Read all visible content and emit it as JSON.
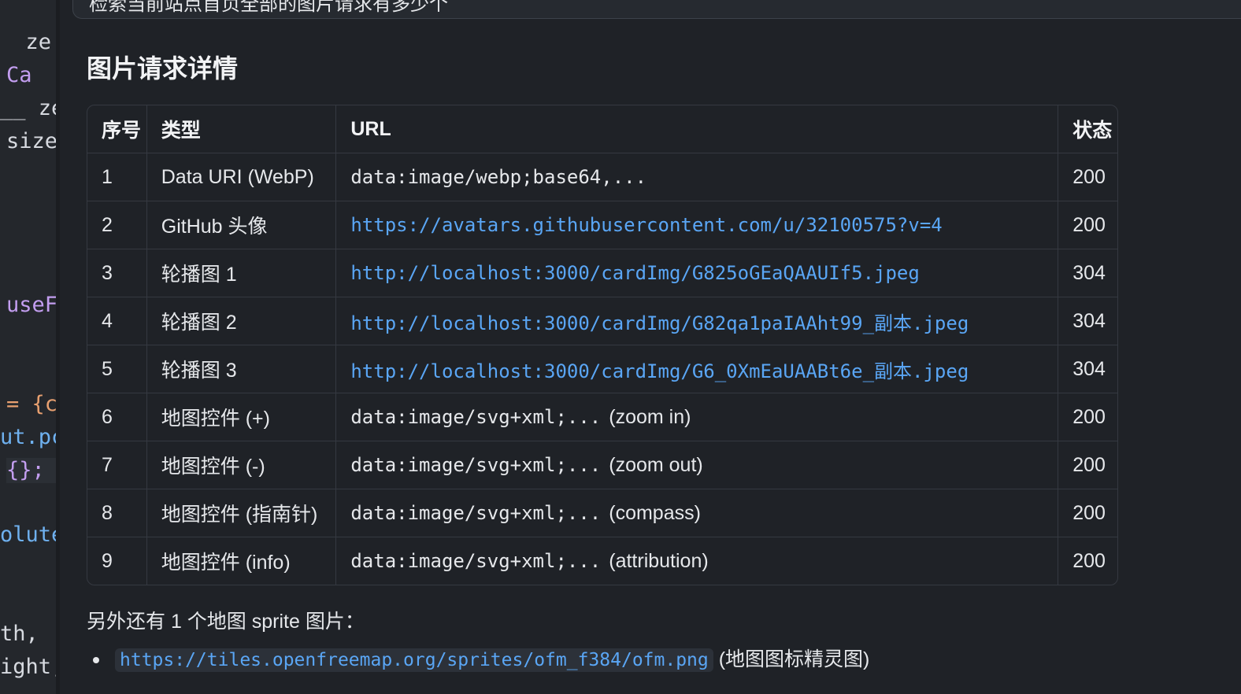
{
  "editor": {
    "lines": [
      {
        "text": "  ze",
        "color": "#d7dae0"
      },
      {
        "text": "Ca  s",
        "color": "#c39ef0"
      },
      {
        "text": "__ ze",
        "color": "#d7dae0"
      },
      {
        "text": "size",
        "color": "#d7dae0"
      },
      {
        "text": "useF",
        "color": "#c39ef0"
      },
      {
        "text": "= {c",
        "color": "#e8a070"
      },
      {
        "text": "ut.pc",
        "color": "#6fb1f0"
      },
      {
        "text": "{};",
        "color": "#c39ef0"
      },
      {
        "text": "olute",
        "color": "#6fb1f0"
      },
      {
        "text": "th,",
        "color": "#d7dae0"
      },
      {
        "text": "ight,",
        "color": "#d7dae0"
      }
    ]
  },
  "prompt": {
    "text": "检索当前站点首页全部的图片请求有多少个"
  },
  "section": {
    "title": "图片请求详情"
  },
  "table": {
    "headers": [
      "序号",
      "类型",
      "URL",
      "状态"
    ],
    "rows": [
      {
        "idx": "1",
        "type": "Data URI (WebP)",
        "url": "data:image/webp;base64,...",
        "url_note": "",
        "is_link": false,
        "status": "200"
      },
      {
        "idx": "2",
        "type": "GitHub 头像",
        "url": "https://avatars.githubusercontent.com/u/32100575?v=4",
        "url_note": "",
        "is_link": true,
        "status": "200"
      },
      {
        "idx": "3",
        "type": "轮播图 1",
        "url": "http://localhost:3000/cardImg/G825oGEaQAAUIf5.jpeg",
        "url_note": "",
        "is_link": true,
        "status": "304"
      },
      {
        "idx": "4",
        "type": "轮播图 2",
        "url": "http://localhost:3000/cardImg/G82qa1paIAAht99_副本.jpeg",
        "url_note": "",
        "is_link": true,
        "status": "304"
      },
      {
        "idx": "5",
        "type": "轮播图 3",
        "url": "http://localhost:3000/cardImg/G6_0XmEaUAABt6e_副本.jpeg",
        "url_note": "",
        "is_link": true,
        "status": "304"
      },
      {
        "idx": "6",
        "type": "地图控件 (+)",
        "url": "data:image/svg+xml;...",
        "url_note": "(zoom in)",
        "is_link": false,
        "status": "200"
      },
      {
        "idx": "7",
        "type": "地图控件 (-)",
        "url": "data:image/svg+xml;...",
        "url_note": "(zoom out)",
        "is_link": false,
        "status": "200"
      },
      {
        "idx": "8",
        "type": "地图控件 (指南针)",
        "url": "data:image/svg+xml;...",
        "url_note": "(compass)",
        "is_link": false,
        "status": "200"
      },
      {
        "idx": "9",
        "type": "地图控件 (info)",
        "url": "data:image/svg+xml;...",
        "url_note": "(attribution)",
        "is_link": false,
        "status": "200"
      }
    ]
  },
  "note": "另外还有 1 个地图 sprite 图片：",
  "sprite": {
    "url": "https://tiles.openfreemap.org/sprites/ofm_f384/ofm.png",
    "desc": "(地图图标精灵图)"
  }
}
